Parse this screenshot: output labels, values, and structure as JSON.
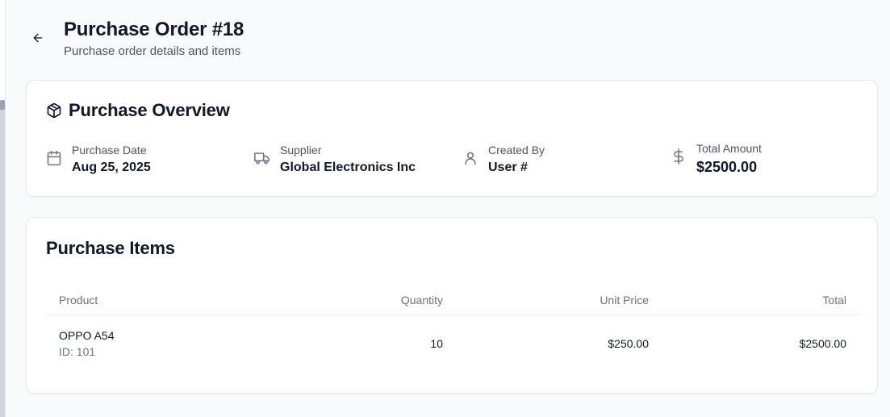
{
  "header": {
    "title": "Purchase Order #18",
    "subtitle": "Purchase order details and items",
    "back_icon": "arrow-left-icon"
  },
  "overview": {
    "title": "Purchase Overview",
    "icon": "package-icon",
    "fields": [
      {
        "label": "Purchase Date",
        "value": "Aug 25, 2025",
        "icon": "calendar-icon"
      },
      {
        "label": "Supplier",
        "value": "Global Electronics Inc",
        "icon": "truck-icon"
      },
      {
        "label": "Created By",
        "value": "User #",
        "icon": "user-icon"
      },
      {
        "label": "Total Amount",
        "value": "$2500.00",
        "icon": "dollar-icon"
      }
    ]
  },
  "items": {
    "title": "Purchase Items",
    "columns": [
      "Product",
      "Quantity",
      "Unit Price",
      "Total"
    ],
    "rows": [
      {
        "product": "OPPO A54",
        "product_id": "ID: 101",
        "quantity": "10",
        "unit_price": "$250.00",
        "total": "$2500.00"
      }
    ]
  },
  "colors": {
    "background": "#f9fafb",
    "card": "#ffffff",
    "text": "#111827",
    "muted": "#6b7280",
    "border": "#e5e7eb"
  }
}
